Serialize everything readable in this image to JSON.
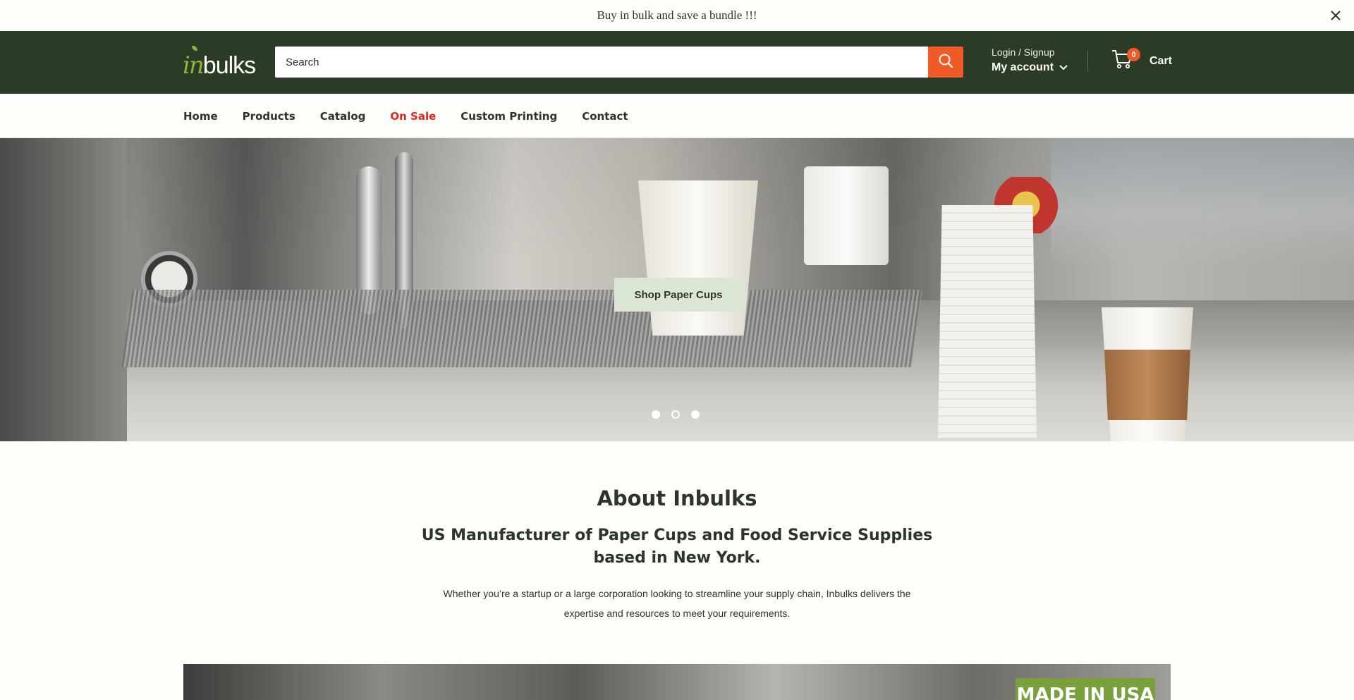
{
  "announcement": {
    "text": "Buy in bulk and save a bundle !!!",
    "close_icon": "close-icon"
  },
  "header": {
    "logo": {
      "prefix": "in",
      "word": "bulks"
    },
    "search": {
      "placeholder": "Search",
      "value": "",
      "icon": "search-icon"
    },
    "account": {
      "login_label": "Login / Signup",
      "my_account_label": "My account",
      "chevron_icon": "chevron-down-icon"
    },
    "cart": {
      "count": "0",
      "label": "Cart",
      "icon": "cart-icon"
    }
  },
  "nav": {
    "items": [
      {
        "label": "Home"
      },
      {
        "label": "Products"
      },
      {
        "label": "Catalog"
      },
      {
        "label": "On Sale"
      },
      {
        "label": "Custom Printing"
      },
      {
        "label": "Contact"
      }
    ]
  },
  "hero": {
    "cta_label": "Shop Paper Cups",
    "slides": 3,
    "active_slide": 2
  },
  "about": {
    "title": "About Inbulks",
    "subtitle": "US Manufacturer of Paper Cups and Food Service Supplies based in New York.",
    "body": "Whether you’re a startup or a large corporation looking to streamline your supply chain, Inbulks delivers the expertise and resources to meet your requirements."
  },
  "banner": {
    "tag": "MADE IN USA"
  },
  "colors": {
    "header_bg": "#2b3b26",
    "accent": "#f05a28",
    "sale": "#e1261c",
    "logo_green": "#8fb23a",
    "cta_bg": "#dce6d6"
  }
}
